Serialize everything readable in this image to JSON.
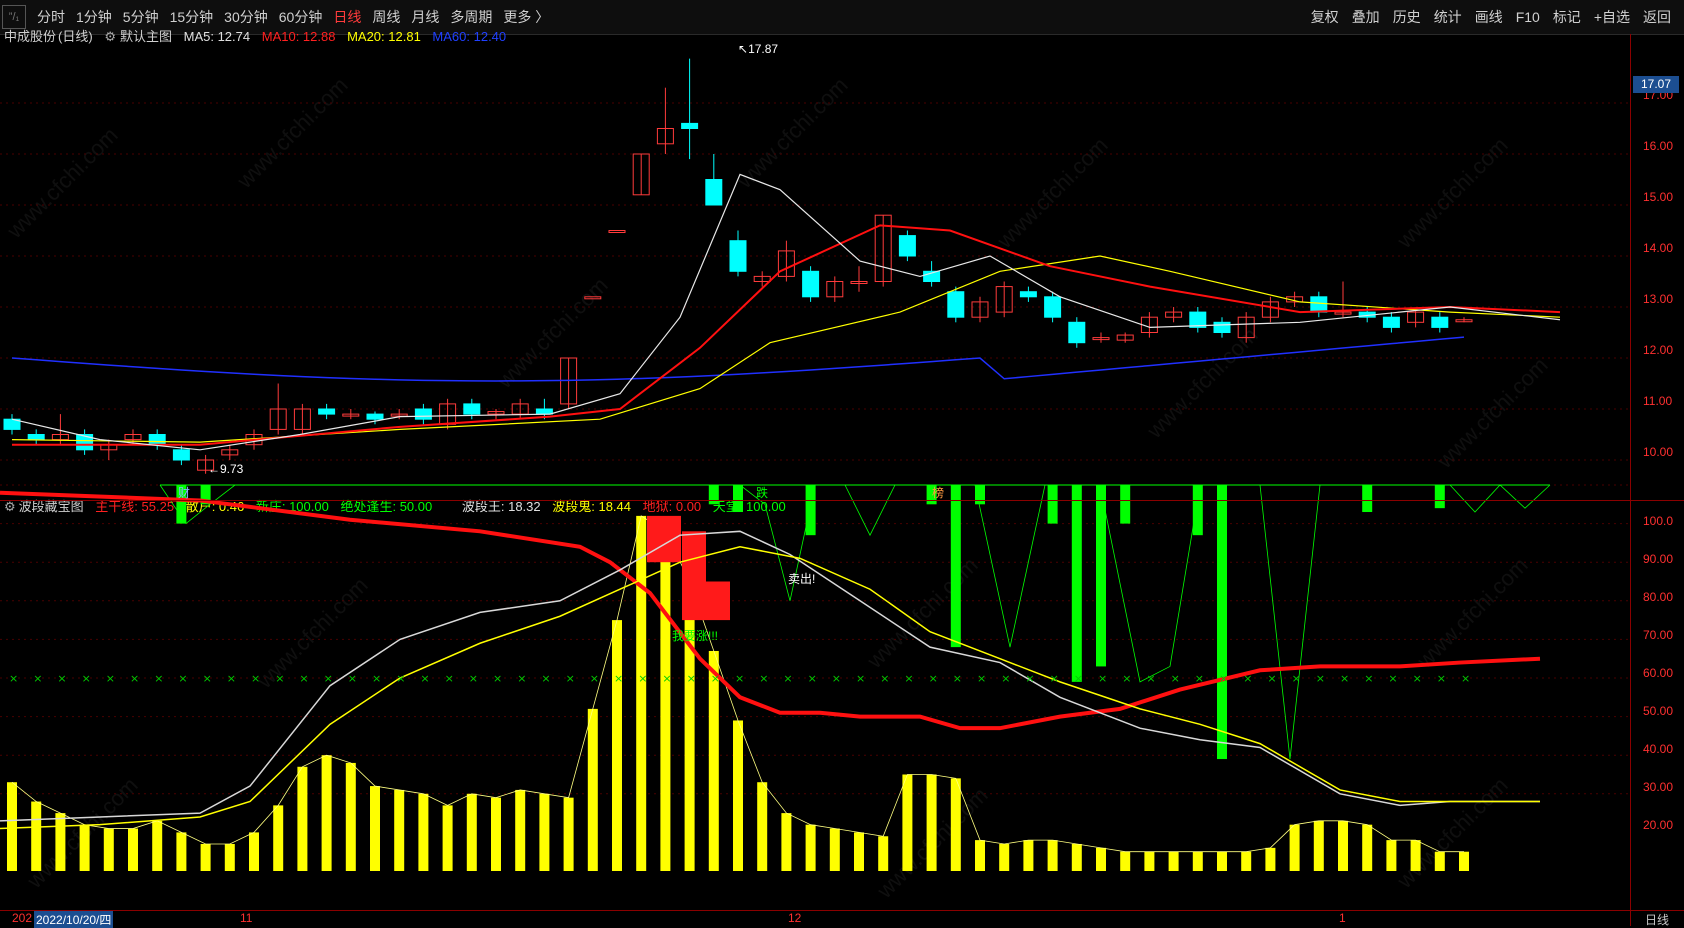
{
  "toolbar": {
    "logo": "”/₁",
    "periods": [
      "分时",
      "1分钟",
      "5分钟",
      "15分钟",
      "30分钟",
      "60分钟",
      "日线",
      "周线",
      "月线",
      "多周期",
      "更多 〉"
    ],
    "active_period": "日线",
    "right_buttons": [
      "复权",
      "叠加",
      "历史",
      "统计",
      "画线",
      "F10",
      "标记",
      "+自选",
      "返回"
    ]
  },
  "main_chart": {
    "stock_name": "中成股份",
    "period_label": "(日线)",
    "template": "默认主图",
    "ma": [
      {
        "label": "MA5: 12.74",
        "color": "#e0e0e0"
      },
      {
        "label": "MA10: 12.88",
        "color": "#ff2020"
      },
      {
        "label": "MA20: 12.81",
        "color": "#ffff00"
      },
      {
        "label": "MA60: 12.40",
        "color": "#2040ff"
      }
    ],
    "current_price": "17.07",
    "high_label": "17.87",
    "low_label": "9.73",
    "axis_ticks": [
      "17.00",
      "16.00",
      "15.00",
      "14.00",
      "13.00",
      "12.00",
      "11.00",
      "10.00"
    ],
    "markers": [
      {
        "text": "财",
        "color": "#8ab4ff"
      },
      {
        "text": "跌",
        "color": "#00ff00"
      },
      {
        "text": "榜",
        "color": "#ff9a40"
      }
    ]
  },
  "indicator": {
    "name": "波段藏宝图",
    "values": [
      {
        "label": "主干线: 55.25",
        "color": "#ff2020"
      },
      {
        "label": "散户: 0.46",
        "color": "#ffff00"
      },
      {
        "label": "新庄: 100.00",
        "color": "#00ff00"
      },
      {
        "label": "绝处逢生: 50.00",
        "color": "#00ff00"
      },
      {
        "label": "波段王: 18.32",
        "color": "#e0e0e0"
      },
      {
        "label": "波段鬼: 18.44",
        "color": "#ffff00"
      },
      {
        "label": "地狱: 0.00",
        "color": "#ff2020"
      },
      {
        "label": "天堂: 100.00",
        "color": "#00ff00"
      }
    ],
    "axis_ticks": [
      "100.0",
      "90.00",
      "80.00",
      "70.00",
      "60.00",
      "50.00",
      "40.00",
      "30.00",
      "20.00"
    ],
    "annotations": {
      "sell": "卖出!",
      "buy": "我要涨!!!"
    }
  },
  "dates": {
    "items": [
      {
        "text": "202",
        "cls": "red"
      },
      {
        "text": "2022/10/20/四",
        "cls": "hl"
      },
      {
        "text": "11",
        "cls": "red"
      },
      {
        "text": "12",
        "cls": "red"
      },
      {
        "text": "1",
        "cls": "red"
      }
    ],
    "right_label": "日线"
  },
  "watermark": "www.cfchi.com"
}
